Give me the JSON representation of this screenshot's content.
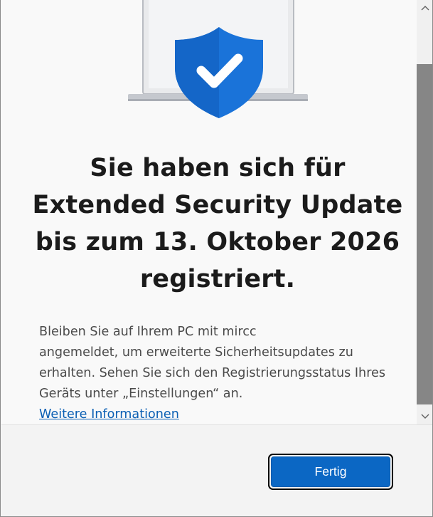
{
  "dialog": {
    "title_lines": [
      "Sie haben sich für",
      "Extended Security Update",
      "bis zum 13. Oktober 2026",
      "registriert."
    ],
    "description_lines": [
      "Bleiben Sie auf Ihrem PC mit mircc",
      "angemeldet, um erweiterte Sicherheitsupdates zu",
      "erhalten. Sehen Sie sich den Registrierungsstatus Ihres",
      "Geräts unter „Einstellungen“ an."
    ],
    "link_label": "Weitere Informationen",
    "done_button_label": "Fertig"
  },
  "icons": {
    "hero": "laptop-with-shield-checkmark-icon",
    "scroll_up": "chevron-up-icon",
    "scroll_down": "chevron-down-icon"
  },
  "colors": {
    "accent": "#0b67c4",
    "link": "#0a5fb4",
    "shield": "#1a73d9"
  }
}
